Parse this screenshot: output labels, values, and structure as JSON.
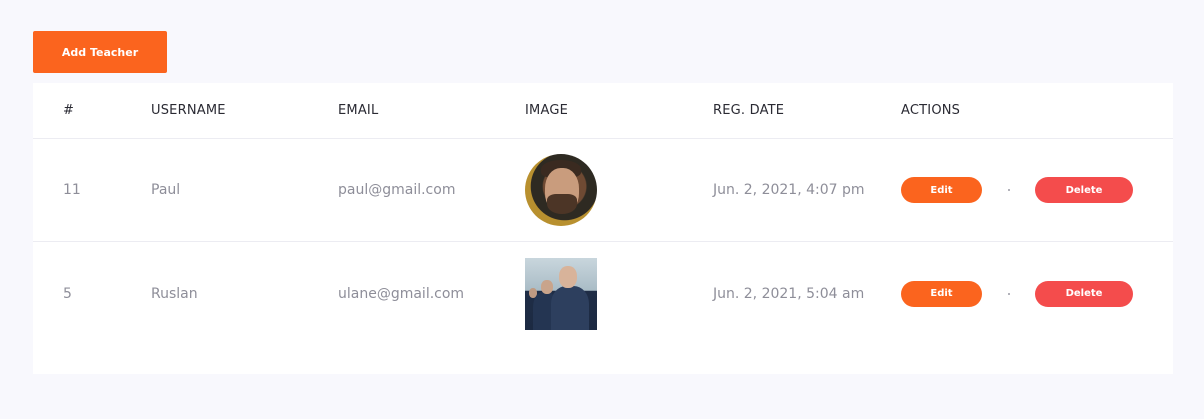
{
  "toolbar": {
    "add_label": "Add Teacher"
  },
  "table": {
    "headers": {
      "num": "#",
      "username": "USERNAME",
      "email": "EMAIL",
      "image": "IMAGE",
      "reg_date": "REG. DATE",
      "actions": "ACTIONS"
    },
    "rows": [
      {
        "id": "11",
        "username": "Paul",
        "email": "paul@gmail.com",
        "reg_date": "Jun. 2, 2021, 4:07 pm",
        "image_shape": "round",
        "edit_label": "Edit",
        "delete_label": "Delete"
      },
      {
        "id": "5",
        "username": "Ruslan",
        "email": "ulane@gmail.com",
        "reg_date": "Jun. 2, 2021, 5:04 am",
        "image_shape": "square",
        "edit_label": "Edit",
        "delete_label": "Delete"
      }
    ]
  },
  "colors": {
    "accent": "#fb641e",
    "danger": "#f44c4c",
    "background": "#f8f8fd"
  }
}
